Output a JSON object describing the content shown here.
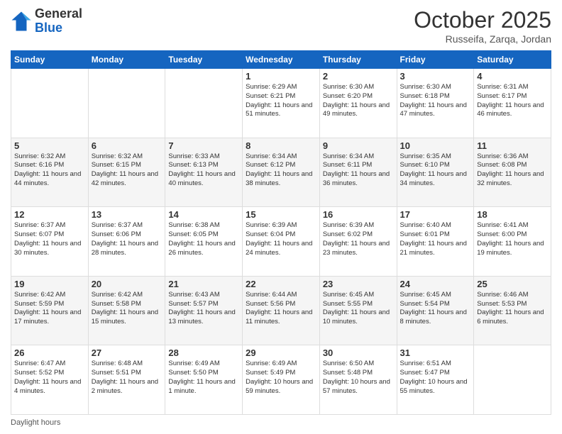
{
  "header": {
    "logo_general": "General",
    "logo_blue": "Blue",
    "month_title": "October 2025",
    "subtitle": "Russeifa, Zarqa, Jordan"
  },
  "footer": {
    "label": "Daylight hours"
  },
  "days_of_week": [
    "Sunday",
    "Monday",
    "Tuesday",
    "Wednesday",
    "Thursday",
    "Friday",
    "Saturday"
  ],
  "weeks": [
    [
      {
        "day": "",
        "info": ""
      },
      {
        "day": "",
        "info": ""
      },
      {
        "day": "",
        "info": ""
      },
      {
        "day": "1",
        "info": "Sunrise: 6:29 AM\nSunset: 6:21 PM\nDaylight: 11 hours\nand 51 minutes."
      },
      {
        "day": "2",
        "info": "Sunrise: 6:30 AM\nSunset: 6:20 PM\nDaylight: 11 hours\nand 49 minutes."
      },
      {
        "day": "3",
        "info": "Sunrise: 6:30 AM\nSunset: 6:18 PM\nDaylight: 11 hours\nand 47 minutes."
      },
      {
        "day": "4",
        "info": "Sunrise: 6:31 AM\nSunset: 6:17 PM\nDaylight: 11 hours\nand 46 minutes."
      }
    ],
    [
      {
        "day": "5",
        "info": "Sunrise: 6:32 AM\nSunset: 6:16 PM\nDaylight: 11 hours\nand 44 minutes."
      },
      {
        "day": "6",
        "info": "Sunrise: 6:32 AM\nSunset: 6:15 PM\nDaylight: 11 hours\nand 42 minutes."
      },
      {
        "day": "7",
        "info": "Sunrise: 6:33 AM\nSunset: 6:13 PM\nDaylight: 11 hours\nand 40 minutes."
      },
      {
        "day": "8",
        "info": "Sunrise: 6:34 AM\nSunset: 6:12 PM\nDaylight: 11 hours\nand 38 minutes."
      },
      {
        "day": "9",
        "info": "Sunrise: 6:34 AM\nSunset: 6:11 PM\nDaylight: 11 hours\nand 36 minutes."
      },
      {
        "day": "10",
        "info": "Sunrise: 6:35 AM\nSunset: 6:10 PM\nDaylight: 11 hours\nand 34 minutes."
      },
      {
        "day": "11",
        "info": "Sunrise: 6:36 AM\nSunset: 6:08 PM\nDaylight: 11 hours\nand 32 minutes."
      }
    ],
    [
      {
        "day": "12",
        "info": "Sunrise: 6:37 AM\nSunset: 6:07 PM\nDaylight: 11 hours\nand 30 minutes."
      },
      {
        "day": "13",
        "info": "Sunrise: 6:37 AM\nSunset: 6:06 PM\nDaylight: 11 hours\nand 28 minutes."
      },
      {
        "day": "14",
        "info": "Sunrise: 6:38 AM\nSunset: 6:05 PM\nDaylight: 11 hours\nand 26 minutes."
      },
      {
        "day": "15",
        "info": "Sunrise: 6:39 AM\nSunset: 6:04 PM\nDaylight: 11 hours\nand 24 minutes."
      },
      {
        "day": "16",
        "info": "Sunrise: 6:39 AM\nSunset: 6:02 PM\nDaylight: 11 hours\nand 23 minutes."
      },
      {
        "day": "17",
        "info": "Sunrise: 6:40 AM\nSunset: 6:01 PM\nDaylight: 11 hours\nand 21 minutes."
      },
      {
        "day": "18",
        "info": "Sunrise: 6:41 AM\nSunset: 6:00 PM\nDaylight: 11 hours\nand 19 minutes."
      }
    ],
    [
      {
        "day": "19",
        "info": "Sunrise: 6:42 AM\nSunset: 5:59 PM\nDaylight: 11 hours\nand 17 minutes."
      },
      {
        "day": "20",
        "info": "Sunrise: 6:42 AM\nSunset: 5:58 PM\nDaylight: 11 hours\nand 15 minutes."
      },
      {
        "day": "21",
        "info": "Sunrise: 6:43 AM\nSunset: 5:57 PM\nDaylight: 11 hours\nand 13 minutes."
      },
      {
        "day": "22",
        "info": "Sunrise: 6:44 AM\nSunset: 5:56 PM\nDaylight: 11 hours\nand 11 minutes."
      },
      {
        "day": "23",
        "info": "Sunrise: 6:45 AM\nSunset: 5:55 PM\nDaylight: 11 hours\nand 10 minutes."
      },
      {
        "day": "24",
        "info": "Sunrise: 6:45 AM\nSunset: 5:54 PM\nDaylight: 11 hours\nand 8 minutes."
      },
      {
        "day": "25",
        "info": "Sunrise: 6:46 AM\nSunset: 5:53 PM\nDaylight: 11 hours\nand 6 minutes."
      }
    ],
    [
      {
        "day": "26",
        "info": "Sunrise: 6:47 AM\nSunset: 5:52 PM\nDaylight: 11 hours\nand 4 minutes."
      },
      {
        "day": "27",
        "info": "Sunrise: 6:48 AM\nSunset: 5:51 PM\nDaylight: 11 hours\nand 2 minutes."
      },
      {
        "day": "28",
        "info": "Sunrise: 6:49 AM\nSunset: 5:50 PM\nDaylight: 11 hours\nand 1 minute."
      },
      {
        "day": "29",
        "info": "Sunrise: 6:49 AM\nSunset: 5:49 PM\nDaylight: 10 hours\nand 59 minutes."
      },
      {
        "day": "30",
        "info": "Sunrise: 6:50 AM\nSunset: 5:48 PM\nDaylight: 10 hours\nand 57 minutes."
      },
      {
        "day": "31",
        "info": "Sunrise: 6:51 AM\nSunset: 5:47 PM\nDaylight: 10 hours\nand 55 minutes."
      },
      {
        "day": "",
        "info": ""
      }
    ]
  ]
}
